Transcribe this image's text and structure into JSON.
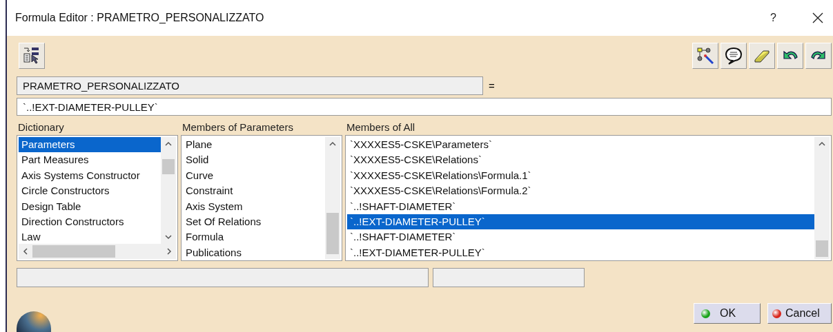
{
  "window": {
    "title": "Formula Editor : PRAMETRO_PERSONALIZZATO",
    "help": "?"
  },
  "parameter": {
    "name": "PRAMETRO_PERSONALIZZATO",
    "equals": "="
  },
  "formula": {
    "value": "`..!EXT-DIAMETER-PULLEY`"
  },
  "lists": [
    {
      "kind": "dictionary",
      "label": "Dictionary",
      "items": [
        {
          "text": "Parameters",
          "selected": true
        },
        {
          "text": "Part Measures",
          "selected": false
        },
        {
          "text": "Axis Systems Constructor",
          "selected": false
        },
        {
          "text": "Circle Constructors",
          "selected": false
        },
        {
          "text": "Design Table",
          "selected": false
        },
        {
          "text": "Direction Constructors",
          "selected": false
        },
        {
          "text": "Law",
          "selected": false
        }
      ]
    },
    {
      "kind": "members",
      "label": "Members of Parameters",
      "items": [
        {
          "text": "Plane",
          "selected": false
        },
        {
          "text": "Solid",
          "selected": false
        },
        {
          "text": "Curve",
          "selected": false
        },
        {
          "text": "Constraint",
          "selected": false
        },
        {
          "text": "Axis System",
          "selected": false
        },
        {
          "text": "Set Of Relations",
          "selected": false
        },
        {
          "text": "Formula",
          "selected": false
        },
        {
          "text": "Publications",
          "selected": false
        }
      ]
    },
    {
      "kind": "all",
      "label": "Members of All",
      "items": [
        {
          "text": "`XXXXES5-CSKE\\Parameters`",
          "selected": false
        },
        {
          "text": "`XXXXES5-CSKE\\Relations`",
          "selected": false
        },
        {
          "text": "`XXXXES5-CSKE\\Relations\\Formula.1`",
          "selected": false
        },
        {
          "text": "`XXXXES5-CSKE\\Relations\\Formula.2`",
          "selected": false
        },
        {
          "text": "`..!SHAFT-DIAMETER`",
          "selected": false
        },
        {
          "text": "`..!EXT-DIAMETER-PULLEY`",
          "selected": true
        },
        {
          "text": "`..!SHAFT-DIAMETER`",
          "selected": false
        },
        {
          "text": "`..!EXT-DIAMETER-PULLEY`",
          "selected": false
        }
      ]
    }
  ],
  "buttons": [
    {
      "kind": "ok",
      "label": "OK"
    },
    {
      "kind": "cancel",
      "label": "Cancel"
    }
  ]
}
